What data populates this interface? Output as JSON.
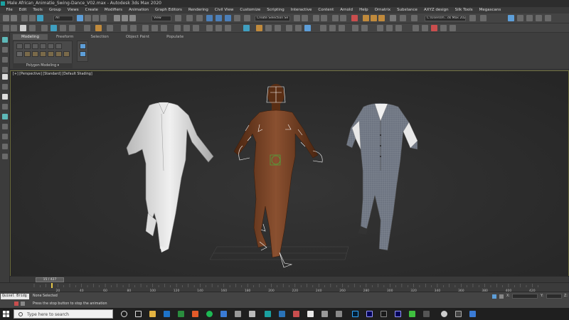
{
  "window": {
    "title": "Male African_Animatie_Swing-Dance_V02.max - Autodesk 3ds Max 2020"
  },
  "menu": {
    "items": [
      "File",
      "Edit",
      "Tools",
      "Group",
      "Views",
      "Create",
      "Modifiers",
      "Animation",
      "Graph Editors",
      "Rendering",
      "Civil View",
      "Customize",
      "Scripting",
      "Interactive",
      "Content",
      "Arnold",
      "Help",
      "Ornatrix",
      "Substance",
      "AXYZ design",
      "Silk Tools",
      "Megascans"
    ]
  },
  "toolbar": {
    "filter_value": "All",
    "view_value": "View",
    "selection_set_value": "Create Selection Se",
    "project_path": "C:\\Users\\m...ds Max 2020"
  },
  "ribbon": {
    "tabs": [
      "Modeling",
      "Freeform",
      "Selection",
      "Object Paint",
      "Populate"
    ],
    "active_tab": "Modeling",
    "panel_label": "Polygon Modeling"
  },
  "viewport": {
    "label": "[+] [Perspective] [Standard] [Default Shading]"
  },
  "timeline": {
    "current_frame_label": "15 / 427",
    "ticks": [
      "20",
      "40",
      "60",
      "80",
      "100",
      "120",
      "140",
      "160",
      "180",
      "200",
      "220",
      "240",
      "260",
      "280",
      "300",
      "320",
      "340",
      "360",
      "380",
      "400",
      "420"
    ],
    "progress": 0.035
  },
  "status": {
    "maxscript_listener": "Quixel Bridg",
    "selection": "None Selected",
    "prompt": "Press the stop button to stop the animation",
    "x_label": "X:",
    "y_label": "Y:",
    "z_label": "Z:"
  },
  "taskbar": {
    "search_placeholder": "Type here to search"
  },
  "colors": {
    "accent_teal": "#1aa1a1",
    "viewport_bg": "#2c2c2c",
    "skin": "#6b3a1c",
    "shirt": "#d8d8d8",
    "vest": "#6e7582"
  }
}
